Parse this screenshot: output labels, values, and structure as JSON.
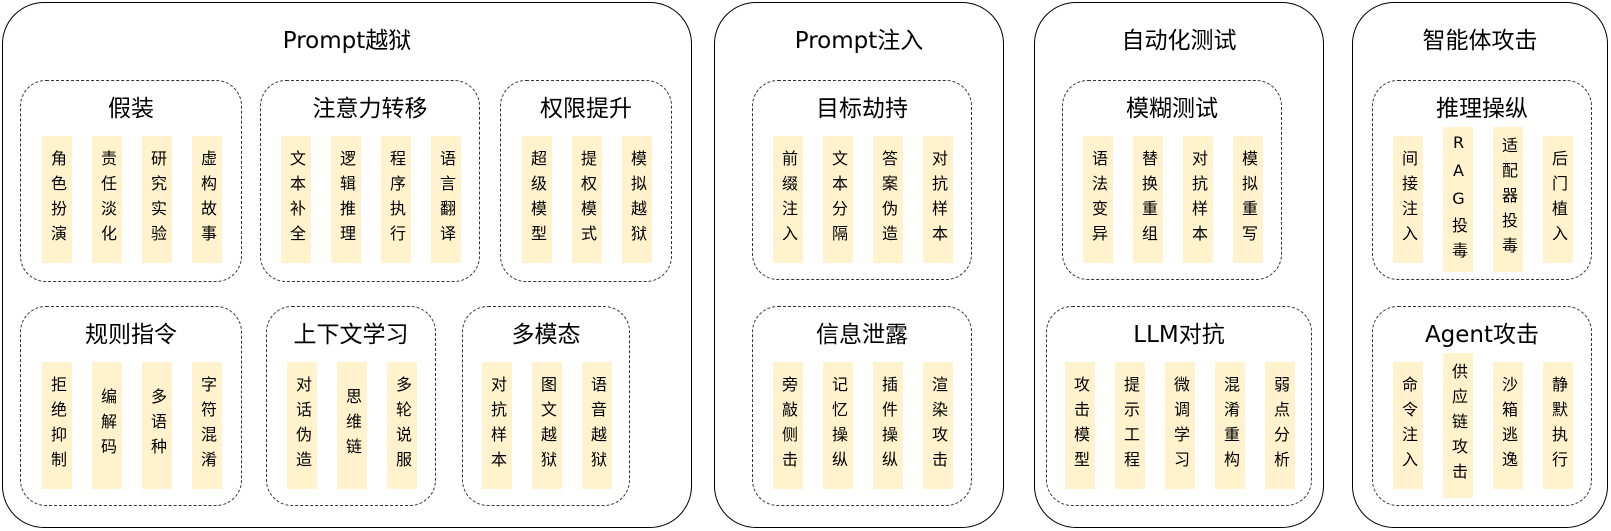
{
  "diagram": {
    "panels": [
      {
        "title": "Prompt越狱",
        "groups": [
          {
            "title": "假装",
            "items": [
              "角色扮演",
              "责任淡化",
              "研究实验",
              "虚构故事"
            ]
          },
          {
            "title": "注意力转移",
            "items": [
              "文本补全",
              "逻辑推理",
              "程序执行",
              "语言翻译"
            ]
          },
          {
            "title": "权限提升",
            "items": [
              "超级模型",
              "提权模式",
              "模拟越狱"
            ]
          },
          {
            "title": "规则指令",
            "items": [
              "拒绝抑制",
              "编解码",
              "多语种",
              "字符混淆"
            ]
          },
          {
            "title": "上下文学习",
            "items": [
              "对话伪造",
              "思维链",
              "多轮说服"
            ]
          },
          {
            "title": "多模态",
            "items": [
              "对抗样本",
              "图文越狱",
              "语音越狱"
            ]
          }
        ]
      },
      {
        "title": "Prompt注入",
        "groups": [
          {
            "title": "目标劫持",
            "items": [
              "前缀注入",
              "文本分隔",
              "答案伪造",
              "对抗样本"
            ]
          },
          {
            "title": "信息泄露",
            "items": [
              "旁敲侧击",
              "记忆操纵",
              "插件操纵",
              "渲染攻击"
            ]
          }
        ]
      },
      {
        "title": "自动化测试",
        "groups": [
          {
            "title": "模糊测试",
            "items": [
              "语法变异",
              "替换重组",
              "对抗样本",
              "模拟重写"
            ]
          },
          {
            "title": "LLM对抗",
            "items": [
              "攻击模型",
              "提示工程",
              "微调学习",
              "混淆重构",
              "弱点分析"
            ]
          }
        ]
      },
      {
        "title": "智能体攻击",
        "groups": [
          {
            "title": "推理操纵",
            "items": [
              "间接注入",
              "RAG投毒",
              "适配器投毒",
              "后门植入"
            ]
          },
          {
            "title": "Agent攻击",
            "items": [
              "命令注入",
              "供应链攻击",
              "沙箱逃逸",
              "静默执行"
            ]
          }
        ]
      }
    ]
  }
}
